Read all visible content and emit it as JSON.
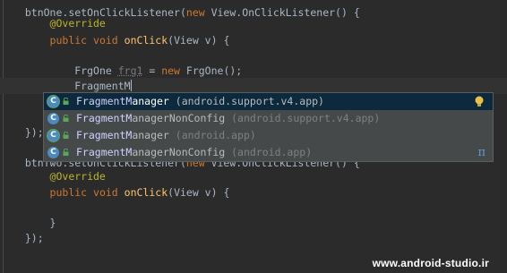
{
  "editor": {
    "lines": [
      {
        "indent": "  ",
        "tokens": [
          {
            "t": "btnOne.setOnClickListener(",
            "c": ""
          },
          {
            "t": "new",
            "c": "kw"
          },
          {
            "t": " View.OnClickListener() {",
            "c": ""
          }
        ]
      },
      {
        "indent": "      ",
        "tokens": [
          {
            "t": "@Override",
            "c": "ann"
          }
        ]
      },
      {
        "indent": "      ",
        "tokens": [
          {
            "t": "public",
            "c": "kw"
          },
          {
            "t": " ",
            "c": ""
          },
          {
            "t": "void",
            "c": "kw"
          },
          {
            "t": " ",
            "c": ""
          },
          {
            "t": "onClick",
            "c": "fn"
          },
          {
            "t": "(View v) {",
            "c": ""
          }
        ]
      },
      {
        "indent": "",
        "tokens": []
      },
      {
        "indent": "          ",
        "tokens": [
          {
            "t": "FrgOne ",
            "c": ""
          },
          {
            "t": "frg1",
            "c": "unused"
          },
          {
            "t": " = ",
            "c": ""
          },
          {
            "t": "new",
            "c": "kw"
          },
          {
            "t": " FrgOne();",
            "c": ""
          }
        ]
      },
      {
        "indent": "          ",
        "tokens": [
          {
            "t": "FragmentM",
            "c": ""
          }
        ],
        "current": true
      },
      {
        "indent": "",
        "tokens": []
      },
      {
        "indent": "",
        "tokens": []
      },
      {
        "indent": "  ",
        "tokens": [
          {
            "t": "});",
            "c": ""
          }
        ]
      },
      {
        "indent": "  ",
        "tokens": [
          {
            "t": "btnTwo.setOnClickListener(",
            "c": ""
          },
          {
            "t": "new",
            "c": "kw"
          },
          {
            "t": " View.OnClickListener() {",
            "c": ""
          }
        ]
      },
      {
        "indent": "      ",
        "tokens": [
          {
            "t": "@Override",
            "c": "ann"
          }
        ]
      },
      {
        "indent": "      ",
        "tokens": [
          {
            "t": "public",
            "c": "kw"
          },
          {
            "t": " ",
            "c": ""
          },
          {
            "t": "void",
            "c": "kw"
          },
          {
            "t": " ",
            "c": ""
          },
          {
            "t": "onClick",
            "c": "fn"
          },
          {
            "t": "(View v) {",
            "c": ""
          }
        ]
      },
      {
        "indent": "",
        "tokens": []
      },
      {
        "indent": "      ",
        "tokens": [
          {
            "t": "}",
            "c": ""
          }
        ]
      },
      {
        "indent": "  ",
        "tokens": [
          {
            "t": "});",
            "c": ""
          }
        ]
      }
    ]
  },
  "completion": {
    "items": [
      {
        "match": "FragmentM",
        "rest": "anager",
        "package": "(android.support.v4.app)",
        "selected": true,
        "icon": "class-icon",
        "ring": true
      },
      {
        "match": "FragmentM",
        "rest": "anagerNonConfig",
        "package": "(android.support.v4.app)",
        "selected": false,
        "icon": "class-icon",
        "ring": false
      },
      {
        "match": "FragmentM",
        "rest": "anager",
        "package": "(android.app)",
        "selected": false,
        "icon": "class-icon",
        "ring": true
      },
      {
        "match": "FragmentM",
        "rest": "anagerNonConfig",
        "package": "(android.app)",
        "selected": false,
        "icon": "class-icon",
        "ring": false
      }
    ],
    "class_glyph": "C",
    "pi_glyph": "π",
    "bulb_icon": "lightbulb-icon"
  },
  "watermark": "www.android-studio.ir"
}
